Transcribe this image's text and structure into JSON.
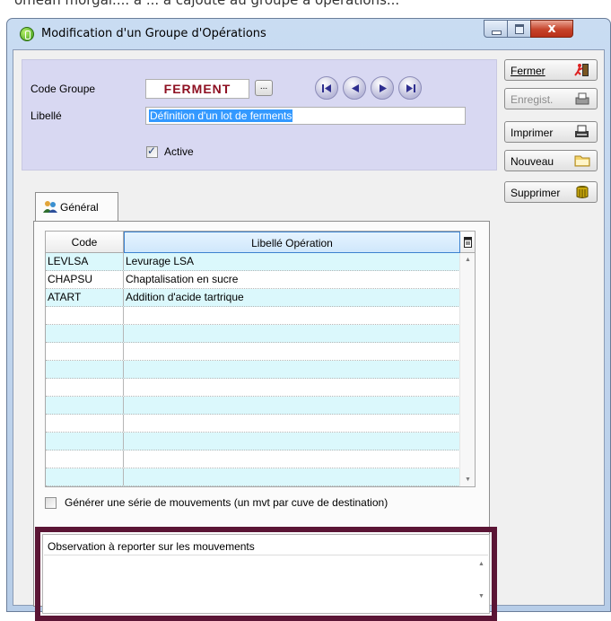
{
  "background_text": "omean morgai.... a ... a cajoute au groupe a operations...",
  "window": {
    "title": "Modification d'un Groupe d'Opérations",
    "close_glyph": "x"
  },
  "header": {
    "code_label": "Code Groupe",
    "code_value": "FERMENT",
    "ellipsis": "...",
    "libelle_label": "Libellé",
    "libelle_value": "Définition d'un lot de ferments",
    "active_label": "Active",
    "active_checked": true
  },
  "navigation": [
    "first-record",
    "previous-record",
    "next-record",
    "last-record"
  ],
  "actions": {
    "close_label": "Fermer",
    "save_label": "Enregist.",
    "print_label": "Imprimer",
    "new_label": "Nouveau",
    "delete_label": "Supprimer"
  },
  "tab": {
    "label": "Général"
  },
  "grid": {
    "columns": [
      "Code",
      "Libellé Opération"
    ],
    "rows": [
      {
        "code": "LEVLSA",
        "label": "Levurage LSA"
      },
      {
        "code": "CHAPSU",
        "label": "Chaptalisation en sucre"
      },
      {
        "code": "ATART",
        "label": "Addition d'acide tartrique"
      }
    ]
  },
  "generate": {
    "label": "Générer une série de mouvements (un mvt par cuve de destination)",
    "checked": false
  },
  "observation": {
    "label": "Observation à reporter sur les mouvements",
    "value": ""
  },
  "colors": {
    "code_text": "#8e1022",
    "header_panel": "#d8d8f2",
    "row_alt": "#dbf8fc",
    "highlight_outline": "#5b1535",
    "selection": "#3399ff"
  },
  "icons": {
    "app": "green-app-icon",
    "close": "running-man-icon",
    "save": "printer-gray-icon",
    "print": "printer-icon",
    "new": "folder-icon",
    "delete": "trash-can-icon",
    "tab": "user-group-icon"
  }
}
